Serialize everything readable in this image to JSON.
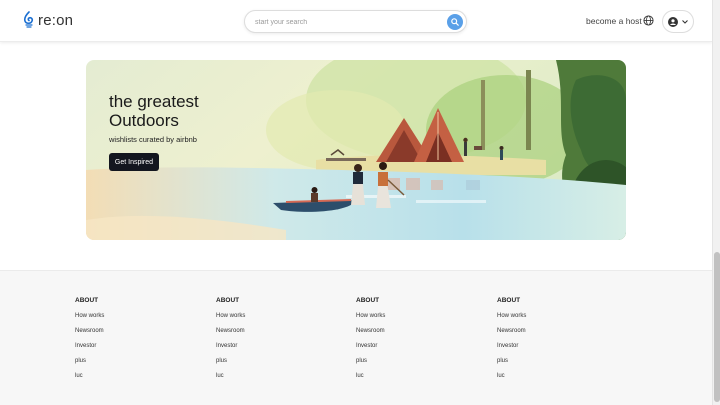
{
  "header": {
    "logo_text": "re:on",
    "search_placeholder": "start your search",
    "host_link": "become a host",
    "icons": {
      "logo": "reon-logo-icon",
      "search": "search-icon",
      "globe": "globe-icon",
      "user": "user-circle-icon",
      "chevron": "chevron-down-icon"
    }
  },
  "banner": {
    "title": "the greatest Outdoors",
    "subtitle": "wishlists curated by airbnb",
    "button_label": "Get Inspired"
  },
  "footer": {
    "columns": [
      {
        "title": "ABOUT",
        "links": [
          "How works",
          "Newsroom",
          "Investor",
          "plus",
          "luc"
        ]
      },
      {
        "title": "ABOUT",
        "links": [
          "How works",
          "Newsroom",
          "Investor",
          "plus",
          "luc"
        ]
      },
      {
        "title": "ABOUT",
        "links": [
          "How works",
          "Newsroom",
          "Investor",
          "plus",
          "luc"
        ]
      },
      {
        "title": "ABOUT",
        "links": [
          "How works",
          "Newsroom",
          "Investor",
          "plus",
          "luc"
        ]
      }
    ]
  },
  "colors": {
    "accent": "#5aa0e8",
    "button_dark": "#13161f",
    "footer_bg": "#f7f7f7"
  }
}
